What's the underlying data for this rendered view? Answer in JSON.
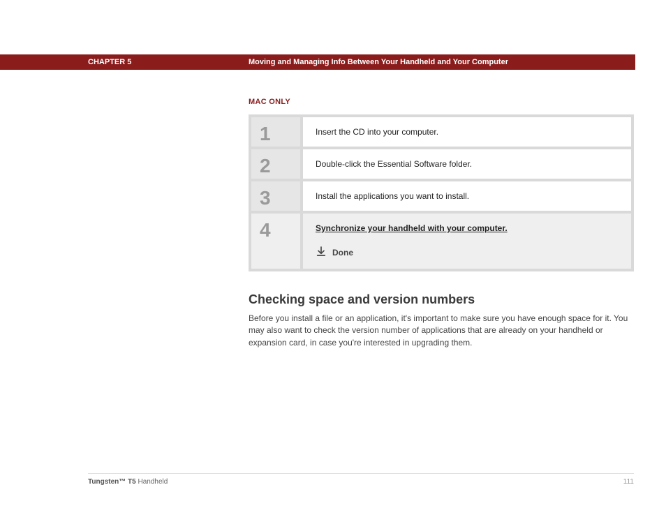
{
  "header": {
    "chapter": "CHAPTER 5",
    "title": "Moving and Managing Info Between Your Handheld and Your Computer"
  },
  "mac_only": "MAC ONLY",
  "steps": [
    {
      "num": "1",
      "text": "Insert the CD into your computer."
    },
    {
      "num": "2",
      "text": "Double-click the Essential Software folder."
    },
    {
      "num": "3",
      "text": "Install the applications you want to install."
    },
    {
      "num": "4",
      "link": "Synchronize your handheld with your computer.",
      "done": "Done"
    }
  ],
  "section": {
    "heading": "Checking space and version numbers",
    "body": "Before you install a file or an application, it's important to make sure you have enough space for it. You may also want to check the version number of applications that are already on your handheld or expansion card, in case you're interested in upgrading them."
  },
  "footer": {
    "product_bold": "Tungsten™ T5",
    "product_rest": " Handheld",
    "page": "111"
  }
}
